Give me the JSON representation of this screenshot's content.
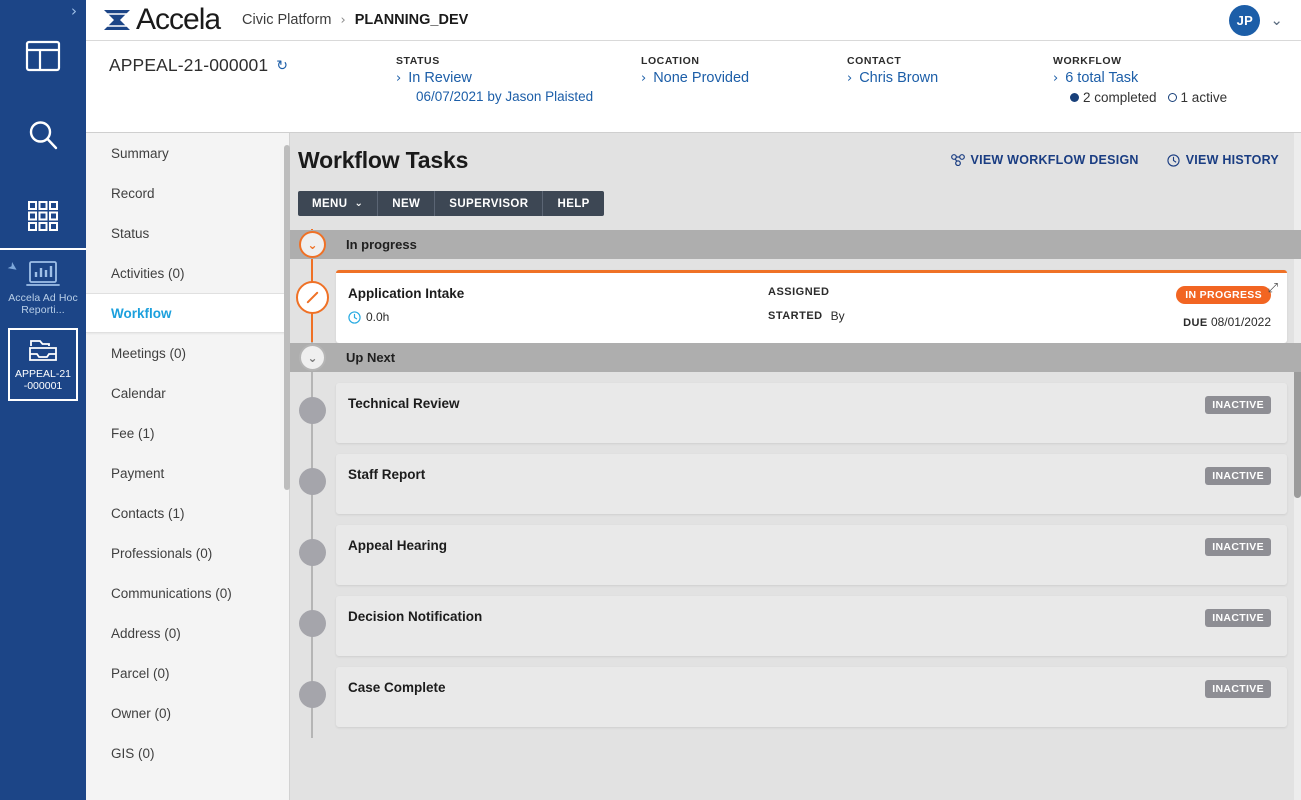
{
  "rail": {
    "expand_label": "›",
    "icons": [
      {
        "name": "dashboard-icon",
        "label": "Dashboard"
      },
      {
        "name": "search-icon",
        "label": "Search"
      },
      {
        "name": "apps-grid-icon",
        "label": "Apps"
      }
    ],
    "pinned": {
      "pin_icon": "📌",
      "label": "Accela Ad Hoc Reporti...",
      "icon_name": "report-chart-icon"
    },
    "active_card": {
      "label": "APPEAL-21 -000001",
      "line1": "APPEAL-21",
      "line2": "-000001",
      "icon_name": "record-folder-icon"
    }
  },
  "topbar": {
    "logo_text": "Accela",
    "breadcrumb": [
      "Civic Platform",
      "PLANNING_DEV"
    ],
    "separator": "›",
    "avatar_initials": "JP",
    "caret": "⌄"
  },
  "record_header": {
    "record_id": "APPEAL-21-000001",
    "refresh_icon": "↻",
    "status": {
      "label": "STATUS",
      "value": "In Review",
      "sub": "06/07/2021 by Jason Plaisted"
    },
    "location": {
      "label": "LOCATION",
      "value": "None Provided"
    },
    "contact": {
      "label": "CONTACT",
      "value": "Chris Brown"
    },
    "workflow": {
      "label": "WORKFLOW",
      "value": "6 total Task",
      "completed": "2 completed",
      "active": "1 active"
    },
    "chevron": "›"
  },
  "nav": {
    "items": [
      {
        "label": "Summary",
        "active": false
      },
      {
        "label": "Record",
        "active": false
      },
      {
        "label": "Status",
        "active": false
      },
      {
        "label": "Activities (0)",
        "active": false
      },
      {
        "label": "Workflow",
        "active": true
      },
      {
        "label": "Meetings (0)",
        "active": false
      },
      {
        "label": "Calendar",
        "active": false
      },
      {
        "label": "Fee (1)",
        "active": false
      },
      {
        "label": "Payment",
        "active": false
      },
      {
        "label": "Contacts (1)",
        "active": false
      },
      {
        "label": "Professionals (0)",
        "active": false
      },
      {
        "label": "Communications (0)",
        "active": false
      },
      {
        "label": "Address (0)",
        "active": false
      },
      {
        "label": "Parcel (0)",
        "active": false
      },
      {
        "label": "Owner (0)",
        "active": false
      },
      {
        "label": "GIS (0)",
        "active": false
      }
    ]
  },
  "main": {
    "title": "Workflow Tasks",
    "links": [
      {
        "label": "VIEW WORKFLOW DESIGN",
        "icon": "workflow-design-icon"
      },
      {
        "label": "VIEW HISTORY",
        "icon": "clock-history-icon"
      }
    ],
    "toolbar": [
      {
        "label": "MENU",
        "caret": "⌄"
      },
      {
        "label": "NEW"
      },
      {
        "label": "SUPERVISOR"
      },
      {
        "label": "HELP"
      }
    ],
    "sections": [
      {
        "heading": "In progress",
        "tasks": [
          {
            "title": "Application Intake",
            "hours": "0.0h",
            "assigned_label": "ASSIGNED",
            "assigned_value": "",
            "started_label": "STARTED",
            "started_value": "By",
            "status_badge": "IN PROGRESS",
            "due_label": "DUE",
            "due_value": "08/01/2022",
            "state": "active"
          }
        ]
      },
      {
        "heading": "Up Next",
        "tasks": [
          {
            "title": "Technical Review",
            "status_badge": "INACTIVE",
            "state": "inactive"
          },
          {
            "title": "Staff Report",
            "status_badge": "INACTIVE",
            "state": "inactive"
          },
          {
            "title": "Appeal Hearing",
            "status_badge": "INACTIVE",
            "state": "inactive"
          },
          {
            "title": "Decision Notification",
            "status_badge": "INACTIVE",
            "state": "inactive"
          },
          {
            "title": "Case Complete",
            "status_badge": "INACTIVE",
            "state": "inactive"
          }
        ]
      }
    ]
  },
  "colors": {
    "brand_navy": "#1c4587",
    "link_blue": "#1c5ea8",
    "accent_orange": "#ef7126",
    "badge_orange": "#f26522",
    "active_cyan": "#1ba0dd",
    "inactive_gray": "#8e8e94"
  }
}
